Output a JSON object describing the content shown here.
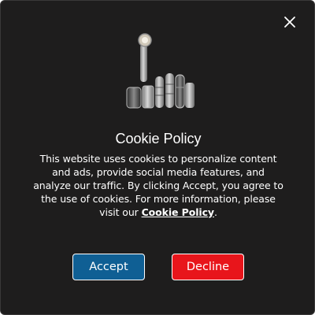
{
  "modal": {
    "close_label": "X",
    "image_alt": "hair care product set",
    "title": "Cookie Policy",
    "body_text": "This website uses cookies to personalize content and ads, provide social media features, and analyze our traffic. By clicking Accept, you agree to the use of cookies. For more information, please visit our",
    "policy_link": "Cookie Policy",
    "body_suffix": ".",
    "accept_label": "Accept",
    "decline_label": "Decline",
    "colors": {
      "background": "#1e1d1d",
      "accept": "#0f5f94",
      "decline": "#e8151b"
    }
  }
}
